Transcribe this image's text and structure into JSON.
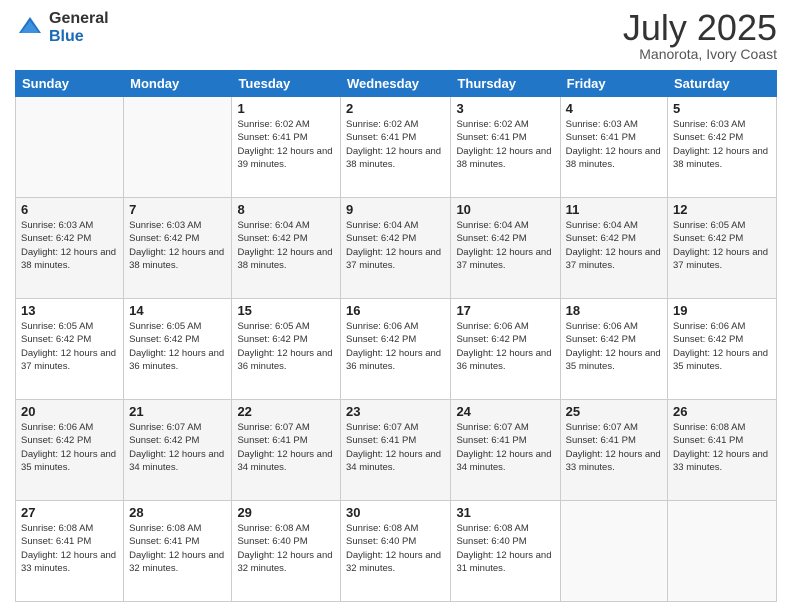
{
  "logo": {
    "general": "General",
    "blue": "Blue"
  },
  "header": {
    "month": "July 2025",
    "location": "Manorota, Ivory Coast"
  },
  "weekdays": [
    "Sunday",
    "Monday",
    "Tuesday",
    "Wednesday",
    "Thursday",
    "Friday",
    "Saturday"
  ],
  "weeks": [
    [
      {
        "day": "",
        "sunrise": "",
        "sunset": "",
        "daylight": ""
      },
      {
        "day": "",
        "sunrise": "",
        "sunset": "",
        "daylight": ""
      },
      {
        "day": "1",
        "sunrise": "Sunrise: 6:02 AM",
        "sunset": "Sunset: 6:41 PM",
        "daylight": "Daylight: 12 hours and 39 minutes."
      },
      {
        "day": "2",
        "sunrise": "Sunrise: 6:02 AM",
        "sunset": "Sunset: 6:41 PM",
        "daylight": "Daylight: 12 hours and 38 minutes."
      },
      {
        "day": "3",
        "sunrise": "Sunrise: 6:02 AM",
        "sunset": "Sunset: 6:41 PM",
        "daylight": "Daylight: 12 hours and 38 minutes."
      },
      {
        "day": "4",
        "sunrise": "Sunrise: 6:03 AM",
        "sunset": "Sunset: 6:41 PM",
        "daylight": "Daylight: 12 hours and 38 minutes."
      },
      {
        "day": "5",
        "sunrise": "Sunrise: 6:03 AM",
        "sunset": "Sunset: 6:42 PM",
        "daylight": "Daylight: 12 hours and 38 minutes."
      }
    ],
    [
      {
        "day": "6",
        "sunrise": "Sunrise: 6:03 AM",
        "sunset": "Sunset: 6:42 PM",
        "daylight": "Daylight: 12 hours and 38 minutes."
      },
      {
        "day": "7",
        "sunrise": "Sunrise: 6:03 AM",
        "sunset": "Sunset: 6:42 PM",
        "daylight": "Daylight: 12 hours and 38 minutes."
      },
      {
        "day": "8",
        "sunrise": "Sunrise: 6:04 AM",
        "sunset": "Sunset: 6:42 PM",
        "daylight": "Daylight: 12 hours and 38 minutes."
      },
      {
        "day": "9",
        "sunrise": "Sunrise: 6:04 AM",
        "sunset": "Sunset: 6:42 PM",
        "daylight": "Daylight: 12 hours and 37 minutes."
      },
      {
        "day": "10",
        "sunrise": "Sunrise: 6:04 AM",
        "sunset": "Sunset: 6:42 PM",
        "daylight": "Daylight: 12 hours and 37 minutes."
      },
      {
        "day": "11",
        "sunrise": "Sunrise: 6:04 AM",
        "sunset": "Sunset: 6:42 PM",
        "daylight": "Daylight: 12 hours and 37 minutes."
      },
      {
        "day": "12",
        "sunrise": "Sunrise: 6:05 AM",
        "sunset": "Sunset: 6:42 PM",
        "daylight": "Daylight: 12 hours and 37 minutes."
      }
    ],
    [
      {
        "day": "13",
        "sunrise": "Sunrise: 6:05 AM",
        "sunset": "Sunset: 6:42 PM",
        "daylight": "Daylight: 12 hours and 37 minutes."
      },
      {
        "day": "14",
        "sunrise": "Sunrise: 6:05 AM",
        "sunset": "Sunset: 6:42 PM",
        "daylight": "Daylight: 12 hours and 36 minutes."
      },
      {
        "day": "15",
        "sunrise": "Sunrise: 6:05 AM",
        "sunset": "Sunset: 6:42 PM",
        "daylight": "Daylight: 12 hours and 36 minutes."
      },
      {
        "day": "16",
        "sunrise": "Sunrise: 6:06 AM",
        "sunset": "Sunset: 6:42 PM",
        "daylight": "Daylight: 12 hours and 36 minutes."
      },
      {
        "day": "17",
        "sunrise": "Sunrise: 6:06 AM",
        "sunset": "Sunset: 6:42 PM",
        "daylight": "Daylight: 12 hours and 36 minutes."
      },
      {
        "day": "18",
        "sunrise": "Sunrise: 6:06 AM",
        "sunset": "Sunset: 6:42 PM",
        "daylight": "Daylight: 12 hours and 35 minutes."
      },
      {
        "day": "19",
        "sunrise": "Sunrise: 6:06 AM",
        "sunset": "Sunset: 6:42 PM",
        "daylight": "Daylight: 12 hours and 35 minutes."
      }
    ],
    [
      {
        "day": "20",
        "sunrise": "Sunrise: 6:06 AM",
        "sunset": "Sunset: 6:42 PM",
        "daylight": "Daylight: 12 hours and 35 minutes."
      },
      {
        "day": "21",
        "sunrise": "Sunrise: 6:07 AM",
        "sunset": "Sunset: 6:42 PM",
        "daylight": "Daylight: 12 hours and 34 minutes."
      },
      {
        "day": "22",
        "sunrise": "Sunrise: 6:07 AM",
        "sunset": "Sunset: 6:41 PM",
        "daylight": "Daylight: 12 hours and 34 minutes."
      },
      {
        "day": "23",
        "sunrise": "Sunrise: 6:07 AM",
        "sunset": "Sunset: 6:41 PM",
        "daylight": "Daylight: 12 hours and 34 minutes."
      },
      {
        "day": "24",
        "sunrise": "Sunrise: 6:07 AM",
        "sunset": "Sunset: 6:41 PM",
        "daylight": "Daylight: 12 hours and 34 minutes."
      },
      {
        "day": "25",
        "sunrise": "Sunrise: 6:07 AM",
        "sunset": "Sunset: 6:41 PM",
        "daylight": "Daylight: 12 hours and 33 minutes."
      },
      {
        "day": "26",
        "sunrise": "Sunrise: 6:08 AM",
        "sunset": "Sunset: 6:41 PM",
        "daylight": "Daylight: 12 hours and 33 minutes."
      }
    ],
    [
      {
        "day": "27",
        "sunrise": "Sunrise: 6:08 AM",
        "sunset": "Sunset: 6:41 PM",
        "daylight": "Daylight: 12 hours and 33 minutes."
      },
      {
        "day": "28",
        "sunrise": "Sunrise: 6:08 AM",
        "sunset": "Sunset: 6:41 PM",
        "daylight": "Daylight: 12 hours and 32 minutes."
      },
      {
        "day": "29",
        "sunrise": "Sunrise: 6:08 AM",
        "sunset": "Sunset: 6:40 PM",
        "daylight": "Daylight: 12 hours and 32 minutes."
      },
      {
        "day": "30",
        "sunrise": "Sunrise: 6:08 AM",
        "sunset": "Sunset: 6:40 PM",
        "daylight": "Daylight: 12 hours and 32 minutes."
      },
      {
        "day": "31",
        "sunrise": "Sunrise: 6:08 AM",
        "sunset": "Sunset: 6:40 PM",
        "daylight": "Daylight: 12 hours and 31 minutes."
      },
      {
        "day": "",
        "sunrise": "",
        "sunset": "",
        "daylight": ""
      },
      {
        "day": "",
        "sunrise": "",
        "sunset": "",
        "daylight": ""
      }
    ]
  ]
}
